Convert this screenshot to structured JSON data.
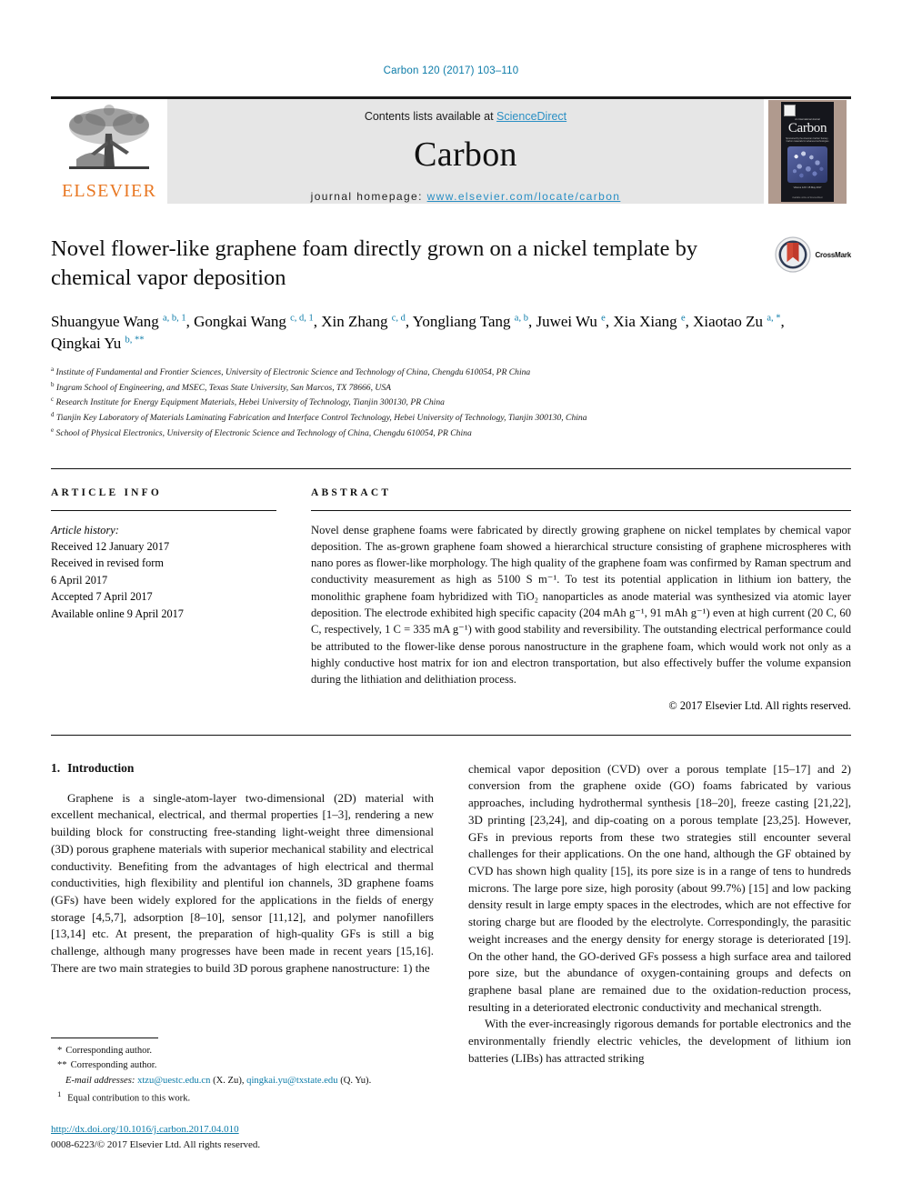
{
  "running_head": "Carbon 120 (2017) 103–110",
  "masthead": {
    "publisher_name": "ELSEVIER",
    "contents_prefix": "Contents lists available at ",
    "contents_link": "ScienceDirect",
    "journal_title": "Carbon",
    "homepage_prefix": "journal homepage: ",
    "homepage_url": "www.elsevier.com/locate/carbon",
    "cover": {
      "journal_name": "Carbon",
      "supertitle": "An International Journal",
      "subtitle": "Sponsored by the American Carbon Society · Carbon materials for advanced technologies",
      "volume_line": "Volume 120 / 15 May 2017",
      "footer": "Available online at\nScienceDirect"
    }
  },
  "article": {
    "title": "Novel flower-like graphene foam directly grown on a nickel template by chemical vapor deposition",
    "crossmark_label": "CrossMark",
    "authors": [
      {
        "name": "Shuangyue Wang",
        "marks": "a, b, 1",
        "sep": ", "
      },
      {
        "name": "Gongkai Wang",
        "marks": "c, d, 1",
        "sep": ", "
      },
      {
        "name": "Xin Zhang",
        "marks": "c, d",
        "sep": ", "
      },
      {
        "name": "Yongliang Tang",
        "marks": "a, b",
        "sep": ", "
      },
      {
        "name": "Juwei Wu",
        "marks": "e",
        "sep": ", "
      },
      {
        "name": "Xia Xiang",
        "marks": "e",
        "sep": ", "
      },
      {
        "name": "Xiaotao Zu",
        "marks": "a, *",
        "sep": ", "
      },
      {
        "name": "Qingkai Yu",
        "marks": "b, **",
        "sep": ""
      }
    ],
    "affiliations": [
      {
        "marker": "a",
        "text": "Institute of Fundamental and Frontier Sciences, University of Electronic Science and Technology of China, Chengdu 610054, PR China"
      },
      {
        "marker": "b",
        "text": "Ingram School of Engineering, and MSEC, Texas State University, San Marcos, TX 78666, USA"
      },
      {
        "marker": "c",
        "text": "Research Institute for Energy Equipment Materials, Hebei University of Technology, Tianjin 300130, PR China"
      },
      {
        "marker": "d",
        "text": "Tianjin Key Laboratory of Materials Laminating Fabrication and Interface Control Technology, Hebei University of Technology, Tianjin 300130, China"
      },
      {
        "marker": "e",
        "text": "School of Physical Electronics, University of Electronic Science and Technology of China, Chengdu 610054, PR China"
      }
    ]
  },
  "article_info": {
    "heading": "ARTICLE INFO",
    "history_label": "Article history:",
    "history": [
      "Received 12 January 2017",
      "Received in revised form",
      "6 April 2017",
      "Accepted 7 April 2017",
      "Available online 9 April 2017"
    ]
  },
  "abstract": {
    "heading": "ABSTRACT",
    "paragraphs": [
      "Novel dense graphene foams were fabricated by directly growing graphene on nickel templates by chemical vapor deposition. The as-grown graphene foam showed a hierarchical structure consisting of graphene microspheres with nano pores as flower-like morphology. The high quality of the graphene foam was confirmed by Raman spectrum and conductivity measurement as high as 5100 S m⁻¹. To test its potential application in lithium ion battery, the monolithic graphene foam hybridized with TiO₂ nanoparticles as anode material was synthesized via atomic layer deposition. The electrode exhibited high specific capacity (204 mAh g⁻¹, 91 mAh g⁻¹) even at high current (20 C, 60 C, respectively, 1 C = 335 mA g⁻¹) with good stability and reversibility. The outstanding electrical performance could be attributed to the flower-like dense porous nanostructure in the graphene foam, which would work not only as a highly conductive host matrix for ion and electron transportation, but also effectively buffer the volume expansion during the lithiation and delithiation process."
    ],
    "copyright": "© 2017 Elsevier Ltd. All rights reserved."
  },
  "introduction": {
    "number": "1.",
    "heading": "Introduction",
    "left_paragraphs": [
      "Graphene is a single-atom-layer two-dimensional (2D) material with excellent mechanical, electrical, and thermal properties [1–3], rendering a new building block for constructing free-standing light-weight three dimensional (3D) porous graphene materials with superior mechanical stability and electrical conductivity. Benefiting from the advantages of high electrical and thermal conductivities, high flexibility and plentiful ion channels, 3D graphene foams (GFs) have been widely explored for the applications in the fields of energy storage [4,5,7], adsorption [8–10], sensor [11,12], and polymer nanofillers [13,14] etc. At present, the preparation of high-quality GFs is still a big challenge, although many progresses have been made in recent years [15,16]. There are two main strategies to build 3D porous graphene nanostructure: 1) the"
    ],
    "right_paragraphs": [
      "chemical vapor deposition (CVD) over a porous template [15–17] and 2) conversion from the graphene oxide (GO) foams fabricated by various approaches, including hydrothermal synthesis [18–20], freeze casting [21,22], 3D printing [23,24], and dip-coating on a porous template [23,25]. However, GFs in previous reports from these two strategies still encounter several challenges for their applications. On the one hand, although the GF obtained by CVD has shown high quality [15], its pore size is in a range of tens to hundreds microns. The large pore size, high porosity (about 99.7%) [15] and low packing density result in large empty spaces in the electrodes, which are not effective for storing charge but are flooded by the electrolyte. Correspondingly, the parasitic weight increases and the energy density for energy storage is deteriorated [19]. On the other hand, the GO-derived GFs possess a high surface area and tailored pore size, but the abundance of oxygen-containing groups and defects on graphene basal plane are remained due to the oxidation-reduction process, resulting in a deteriorated electronic conductivity and mechanical strength.",
      "With the ever-increasingly rigorous demands for portable electronics and the environmentally friendly electric vehicles, the development of lithium ion batteries (LIBs) has attracted striking"
    ]
  },
  "footnotes": {
    "corresponding_1": {
      "marker": "*",
      "text": "Corresponding author."
    },
    "corresponding_2": {
      "marker": "**",
      "text": "Corresponding author."
    },
    "email_label": "E-mail addresses:",
    "email_1": "xtzu@uestc.edu.cn",
    "email_1_owner": "(X. Zu)",
    "email_2": "qingkai.yu@txstate.edu",
    "email_2_owner": "(Q. Yu).",
    "equal_marker": "1",
    "equal_text": "Equal contribution to this work.",
    "doi": "http://dx.doi.org/10.1016/j.carbon.2017.04.010",
    "issn_line": "0008-6223/© 2017 Elsevier Ltd. All rights reserved."
  },
  "colors": {
    "link": "#0b7ba8",
    "elsevier_orange": "#E87722",
    "masthead_gray": "#e6e6e6"
  }
}
